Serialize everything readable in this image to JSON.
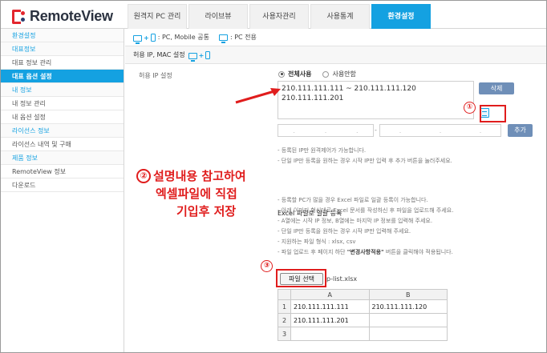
{
  "app": {
    "logo_text": "RemoteView"
  },
  "nav": {
    "tabs": [
      {
        "label": "원격지 PC 관리"
      },
      {
        "label": "라이브뷰"
      },
      {
        "label": "사용자관리"
      },
      {
        "label": "사용통계"
      },
      {
        "label": "환경설정",
        "active": true
      }
    ]
  },
  "sidebar": {
    "items": [
      {
        "label": "환경설정",
        "kind": "section"
      },
      {
        "label": "대표정보",
        "kind": "section"
      },
      {
        "label": "대표 정보 관리",
        "kind": "item"
      },
      {
        "label": "대표 옵션 설정",
        "kind": "active"
      },
      {
        "label": "내 정보",
        "kind": "section"
      },
      {
        "label": "내 정보 관리",
        "kind": "item"
      },
      {
        "label": "내 옵션 설정",
        "kind": "item"
      },
      {
        "label": "라이선스 정보",
        "kind": "section"
      },
      {
        "label": "라이선스 내역 및 구매",
        "kind": "item"
      },
      {
        "label": "제품 정보",
        "kind": "section"
      },
      {
        "label": "RemoteView 정보",
        "kind": "item"
      },
      {
        "label": "다운로드",
        "kind": "item"
      }
    ]
  },
  "legend": {
    "common_label": ": PC, Mobile 공통",
    "pc_label": ": PC 전용"
  },
  "section": {
    "title": "허용 IP, MAC 설정"
  },
  "ip_settings": {
    "label": "허용 IP 설정",
    "radio_all": "전체사용",
    "radio_none": "사용안함",
    "entries": [
      "210.111.111.111 ~ 210.111.111.120",
      "210.111.111.201"
    ],
    "delete_label": "삭제",
    "add_label": "추가",
    "notes": [
      "- 등록된 IP만 원격제어가 가능합니다.",
      "- 단일 IP만 등록을 원하는 경우 시작 IP만 입력 후 추가 버튼을 눌러주세요."
    ]
  },
  "excel": {
    "title": "Excel 파일로 일괄 등록",
    "notes": [
      "- 등록할 PC가 많을 경우 Excel 파일로 일괄 등록이 가능합니다.",
      "- 아래 이미지 형식대로 Excel 문서를 작성하신 후 파일을 업로드해 주세요.",
      "- A열에는 시작 IP 정보, B열에는 마지막 IP 정보를 입력해 주세요.",
      "- 단일 IP만 등록을 원하는 경우 시작 IP만 입력해 주세요.",
      "- 지원하는 파일 형식 : xlsx, csv"
    ],
    "last_note_prefix": "- 파일 업로드 후 페이지 하단 ",
    "last_note_bold": "\"변경사항적용\"",
    "last_note_suffix": " 버튼을 클릭해야 적용됩니다.",
    "file_button": "파일 선택",
    "file_name": "p-list.xlsx"
  },
  "sheet": {
    "columns": [
      "",
      "A",
      "B"
    ],
    "rows": [
      {
        "num": "1",
        "a": "210.111.111.111",
        "b": "210.111.111.120"
      },
      {
        "num": "2",
        "a": "210.111.111.201",
        "b": ""
      },
      {
        "num": "3",
        "a": "",
        "b": ""
      }
    ]
  },
  "annotations": {
    "marker1": "①",
    "marker2": "②",
    "marker3": "③",
    "instruction_lines": [
      "설명내용 참고하여",
      "엑셀파일에 직접",
      "기입후 저장"
    ],
    "color": "#e01d1d"
  },
  "colors": {
    "accent": "#14a1e1",
    "brand_red": "#e3262e",
    "button": "#6f8fb8"
  }
}
